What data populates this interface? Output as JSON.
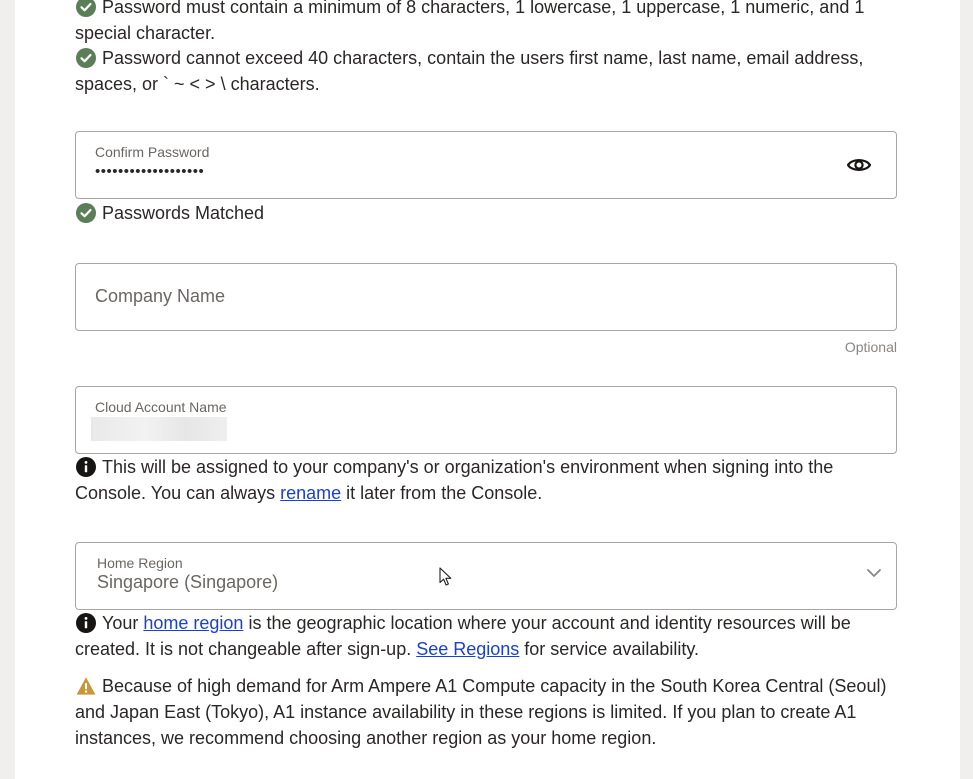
{
  "password_rules": {
    "rule_min": "Password must contain a minimum of 8 characters, 1 lowercase, 1 uppercase, 1 numeric, and 1 special character.",
    "rule_max": "Password cannot exceed 40 characters, contain the users first name, last name, email address, spaces, or ` ~ < > \\ characters."
  },
  "confirm_password": {
    "label": "Confirm Password",
    "value": "•••••••••••••••••••"
  },
  "passwords_matched": "Passwords Matched",
  "company_name": {
    "placeholder": "Company Name",
    "optional": "Optional"
  },
  "cloud_account": {
    "label": "Cloud Account Name",
    "info_before": "This will be assigned to your company's or organization's environment when signing into the Console. You can always ",
    "info_link": "rename",
    "info_after": " it later from the Console."
  },
  "home_region": {
    "label": "Home Region",
    "value": "Singapore (Singapore)",
    "info_before": "Your ",
    "info_link1": "home region",
    "info_middle": " is the geographic location where your account and identity resources will be created. It is not changeable after sign-up. ",
    "info_link2": "See Regions",
    "info_after": " for service availability.",
    "warning": "Because of high demand for Arm Ampere A1 Compute capacity in the South Korea Central (Seoul) and Japan East (Tokyo), A1 instance availability in these regions is limited. If you plan to create A1 instances, we recommend choosing another region as your home region."
  },
  "colors": {
    "success": "#5b7e59",
    "info": "#161513",
    "warning": "#c9963a",
    "link": "#1a3fd6"
  }
}
